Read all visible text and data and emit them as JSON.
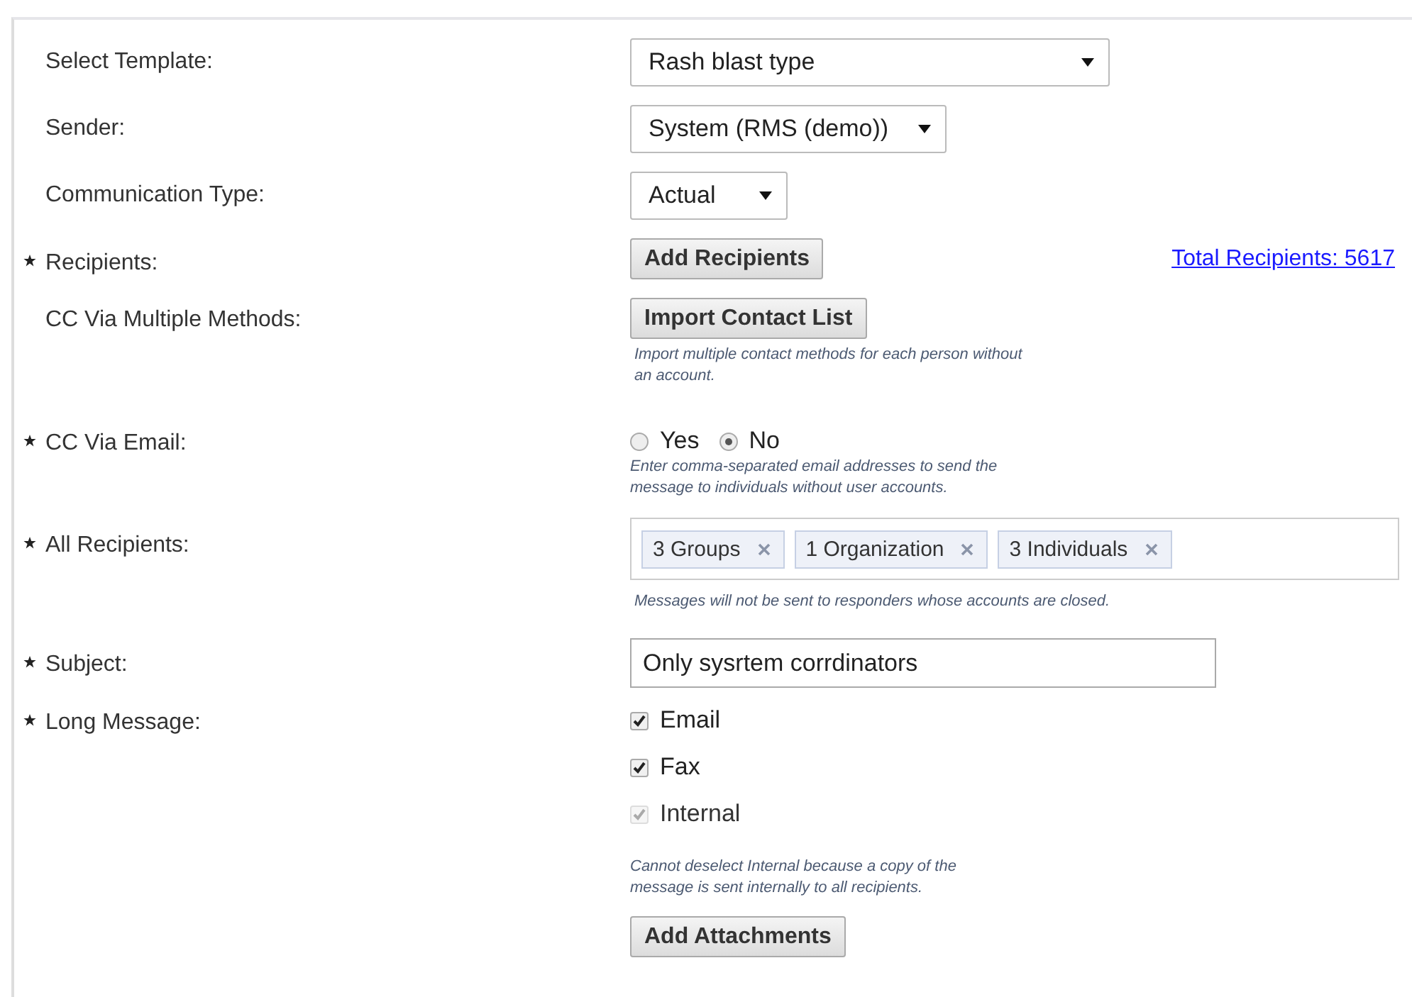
{
  "form": {
    "rows": [
      {
        "label": "Select Template:",
        "required": false,
        "kind": "select",
        "value": "Rash blast type"
      },
      {
        "label": "Sender:",
        "required": false,
        "kind": "select",
        "value": "System (RMS (demo))"
      },
      {
        "label": "Communication Type:",
        "required": false,
        "kind": "select",
        "value": "Actual"
      },
      {
        "label": "Recipients:",
        "required": true,
        "kind": "button",
        "button": "Add Recipients",
        "link": "Total Recipients: 5617"
      },
      {
        "label": "CC Via Multiple Methods:",
        "required": false,
        "kind": "button",
        "button": "Import Contact List",
        "hint": "Import multiple contact methods for each person without an account."
      },
      {
        "label": "CC Via Email:",
        "required": true,
        "kind": "radios",
        "options": [
          {
            "label": "Yes",
            "selected": false
          },
          {
            "label": "No",
            "selected": true
          }
        ],
        "hint": "Enter comma-separated email addresses to send the message to individuals without user accounts."
      },
      {
        "label": "All Recipients:",
        "required": true,
        "kind": "tags",
        "tags": [
          "3 Groups",
          "1 Organization",
          "3 Individuals"
        ],
        "hint": "Messages will not be sent to responders whose accounts are closed."
      },
      {
        "label": "Subject:",
        "required": true,
        "kind": "text",
        "value": "Only sysrtem corrdinators"
      },
      {
        "label": "Long Message:",
        "required": true,
        "kind": "checkboxes",
        "options": [
          {
            "label": "Email",
            "checked": true,
            "disabled": false
          },
          {
            "label": "Fax",
            "checked": true,
            "disabled": false
          },
          {
            "label": "Internal",
            "checked": true,
            "disabled": true
          }
        ],
        "hint": "Cannot deselect Internal because a copy of the message is sent internally to all recipients.",
        "button": "Add Attachments"
      }
    ]
  }
}
